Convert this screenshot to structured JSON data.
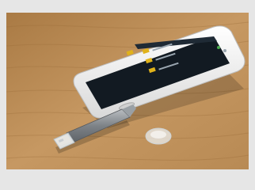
{
  "photo": {
    "subject": "smartphone-with-usb-otg-flash-drive-on-wooden-table",
    "colors": {
      "background_frame": "#e6e6e6",
      "wood": "#b88d55",
      "phone_body": "#f2f2f2",
      "screen": "#121a22",
      "folder_icon": "#e0b21a",
      "drive_metal": "#8a8f95",
      "cap_translucent": "#e9edef"
    },
    "screen_items": [
      "",
      "",
      "",
      ""
    ]
  }
}
